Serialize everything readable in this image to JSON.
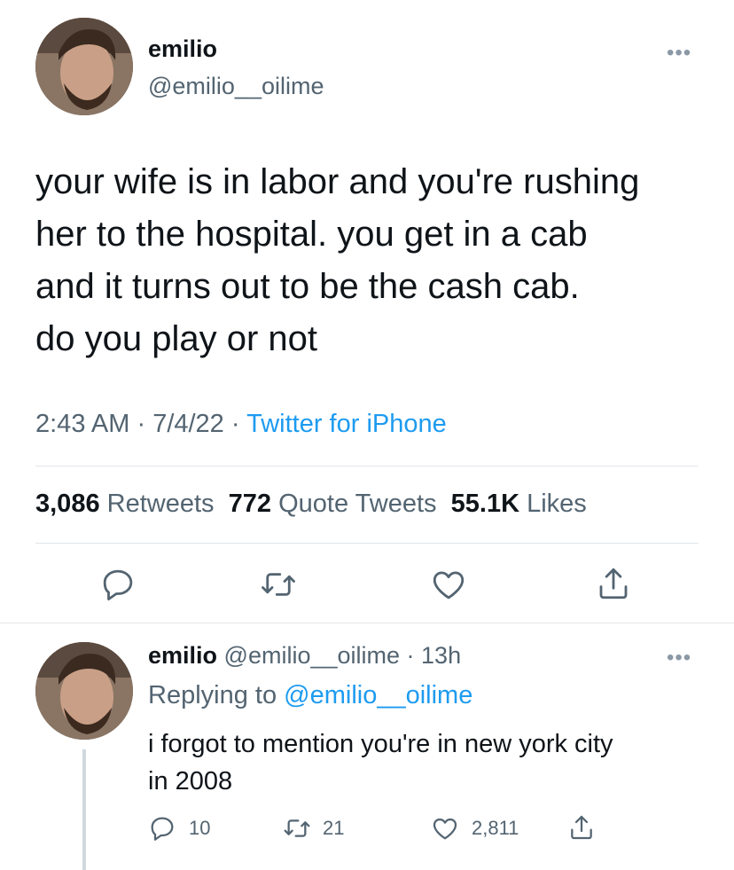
{
  "main_tweet": {
    "author_name": "emilio",
    "author_handle": "@emilio__oilime",
    "text_lines": [
      "your wife is in labor and you're rushing",
      "her to the hospital. you get in a cab",
      "and it turns out to be the cash cab.",
      "do you play or not"
    ],
    "time": "2:43 AM",
    "date": "7/4/22",
    "source": "Twitter for iPhone",
    "retweets_count": "3,086",
    "retweets_label": "Retweets",
    "quotes_count": "772",
    "quotes_label": "Quote Tweets",
    "likes_count": "55.1K",
    "likes_label": "Likes",
    "more_glyph": "•••"
  },
  "reply_tweet": {
    "author_name": "emilio",
    "author_handle": "@emilio__oilime",
    "time_ago": "13h",
    "replying_prefix": "Replying to",
    "replying_to": "@emilio__oilime",
    "text_lines": [
      "i forgot to mention you're in new york city",
      "in 2008"
    ],
    "reply_count": "10",
    "retweet_count": "21",
    "like_count": "2,811",
    "more_glyph": "•••"
  },
  "icons": {
    "reply": "reply-icon",
    "retweet": "retweet-icon",
    "like": "heart-icon",
    "share": "share-icon"
  }
}
